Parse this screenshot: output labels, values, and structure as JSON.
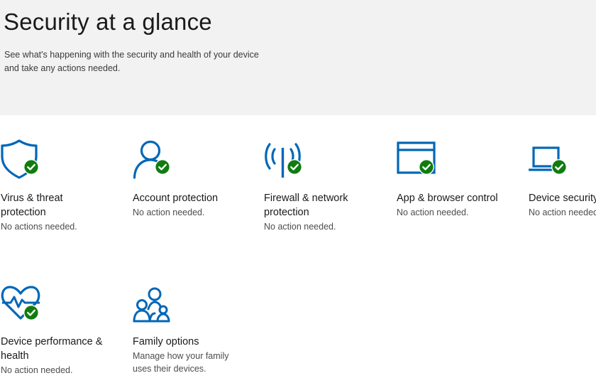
{
  "header": {
    "title": "Security at a glance",
    "subtitle_line1": "See what's happening with the security and health of your device",
    "subtitle_line2": "and take any actions needed."
  },
  "accent_color": "#0067b8",
  "ok_color": "#107c10",
  "tiles": [
    {
      "icon": "shield-icon",
      "title_line1": "Virus & threat",
      "title_line2": "protection",
      "status_line1": "No actions needed."
    },
    {
      "icon": "person-icon",
      "title_line1": "Account protection",
      "status_line1": "No action needed."
    },
    {
      "icon": "wifi-antenna-icon",
      "title_line1": "Firewall & network",
      "title_line2": "protection",
      "status_line1": "No action needed."
    },
    {
      "icon": "browser-window-icon",
      "title_line1": "App & browser control",
      "status_line1": "No action needed."
    },
    {
      "icon": "laptop-icon",
      "title_line1": "Device security",
      "status_line1": "No action needed."
    },
    {
      "icon": "heart-pulse-icon",
      "title_line1": "Device performance &",
      "title_line2": "health",
      "status_line1": "No action needed."
    },
    {
      "icon": "family-icon",
      "title_line1": "Family options",
      "status_line1": "Manage how your family",
      "status_line2": "uses their devices."
    }
  ]
}
